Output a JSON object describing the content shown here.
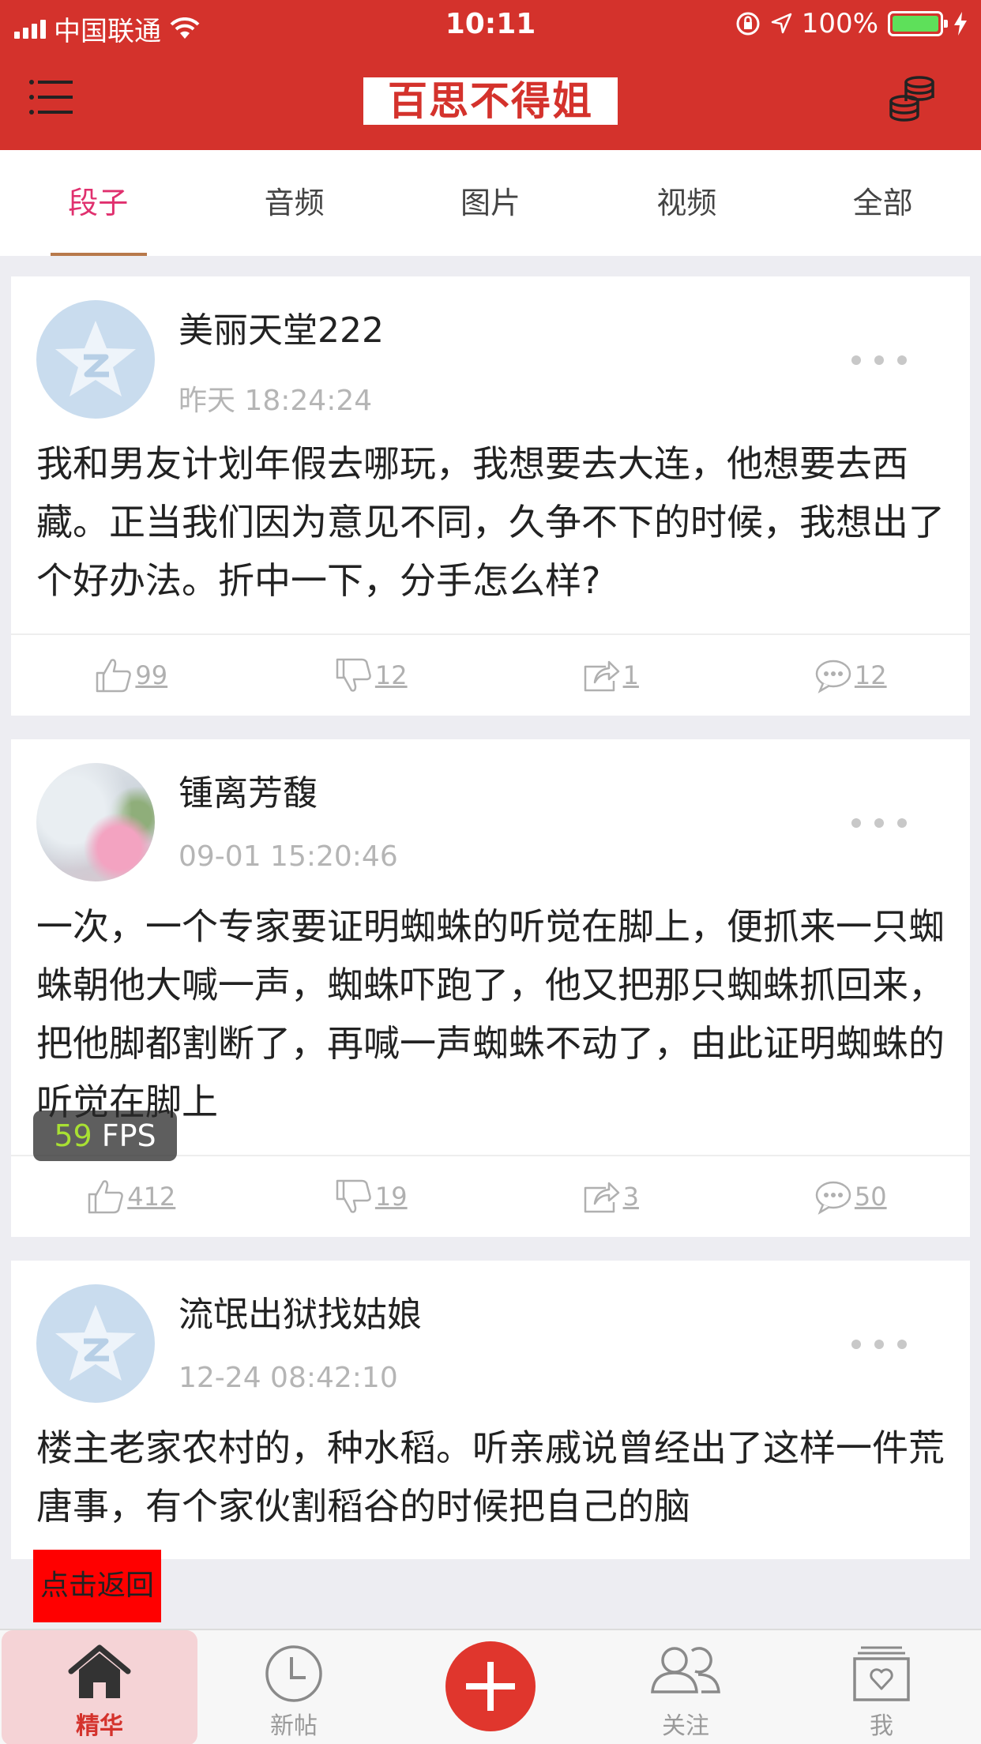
{
  "status_bar": {
    "carrier": "中国联通",
    "time": "10:11",
    "battery": "100%",
    "battery_color": "#5ee05a"
  },
  "header": {
    "logo_text": "百思不得姐",
    "menu_icon": "menu-icon",
    "right_icon": "coins-icon",
    "bg_color": "#d4322c"
  },
  "tabs": [
    {
      "label": "段子",
      "active": true
    },
    {
      "label": "音频",
      "active": false
    },
    {
      "label": "图片",
      "active": false
    },
    {
      "label": "视频",
      "active": false
    },
    {
      "label": "全部",
      "active": false
    }
  ],
  "posts": [
    {
      "username": "美丽天堂222",
      "time": "昨天 18:24:24",
      "avatar": "qq-default-avatar",
      "content": "我和男友计划年假去哪玩，我想要去大连，他想要去西藏。正当我们因为意见不同，久争不下的时候，我想出了个好办法。折中一下，分手怎么样?",
      "likes": "99",
      "dislikes": "12",
      "shares": "1",
      "comments": "12"
    },
    {
      "username": "锺离芳馥",
      "time": "09-01 15:20:46",
      "avatar": "flower-photo-avatar",
      "content": "一次，一个专家要证明蜘蛛的听觉在脚上，便抓来一只蜘蛛朝他大喊一声，蜘蛛吓跑了，他又把那只蜘蛛抓回来，把他脚都割断了，再喊一声蜘蛛不动了，由此证明蜘蛛的听觉在脚上",
      "likes": "412",
      "dislikes": "19",
      "shares": "3",
      "comments": "50"
    },
    {
      "username": "流氓出狱找姑娘",
      "time": "12-24 08:42:10",
      "avatar": "qq-default-avatar",
      "content": "楼主老家农村的，种水稻。听亲戚说曾经出了这样一件荒唐事，有个家伙割稻谷的时候把自己的脑",
      "likes": "",
      "dislikes": "",
      "shares": "",
      "comments": ""
    }
  ],
  "overlays": {
    "fps_value": "59",
    "fps_unit": "FPS",
    "back_label": "点击返回"
  },
  "tabbar": {
    "items": [
      {
        "label": "精华",
        "icon": "home-icon",
        "active": true
      },
      {
        "label": "新帖",
        "icon": "clock-icon",
        "active": false
      },
      {
        "label": "",
        "icon": "plus-icon",
        "active": false
      },
      {
        "label": "关注",
        "icon": "friends-icon",
        "active": false
      },
      {
        "label": "我",
        "icon": "profile-icon",
        "active": false
      }
    ]
  }
}
